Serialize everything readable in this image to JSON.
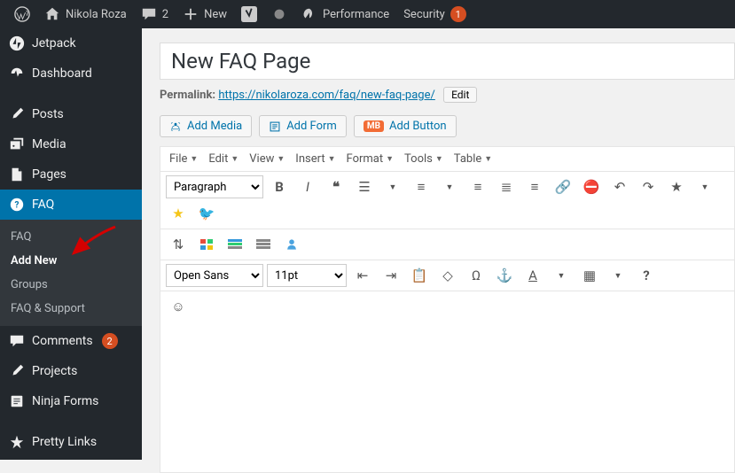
{
  "toolbar": {
    "site": "Nikola Roza",
    "comments": "2",
    "new": "New",
    "perf": "Performance",
    "sec": "Security",
    "sec_badge": "1"
  },
  "sidebar": {
    "items": [
      {
        "label": "Jetpack"
      },
      {
        "label": "Dashboard"
      },
      {
        "label": "Posts"
      },
      {
        "label": "Media"
      },
      {
        "label": "Pages"
      },
      {
        "label": "FAQ"
      },
      {
        "label": "Comments",
        "badge": "2"
      },
      {
        "label": "Projects"
      },
      {
        "label": "Ninja Forms"
      },
      {
        "label": "Pretty Links"
      }
    ],
    "sub": [
      {
        "label": "FAQ"
      },
      {
        "label": "Add New"
      },
      {
        "label": "Groups"
      },
      {
        "label": "FAQ & Support"
      }
    ]
  },
  "page": {
    "title": "New FAQ Page",
    "permalink_label": "Permalink:",
    "permalink_base": "https://nikolaroza.com/faq/",
    "permalink_slug": "new-faq-page/",
    "edit": "Edit"
  },
  "buttons": {
    "add_media": "Add Media",
    "add_form": "Add Form",
    "add_button": "Add Button",
    "ob": "MB"
  },
  "editor": {
    "menus": [
      "File",
      "Edit",
      "View",
      "Insert",
      "Format",
      "Tools",
      "Table"
    ],
    "paragraph": "Paragraph",
    "font": "Open Sans",
    "size": "11pt"
  }
}
